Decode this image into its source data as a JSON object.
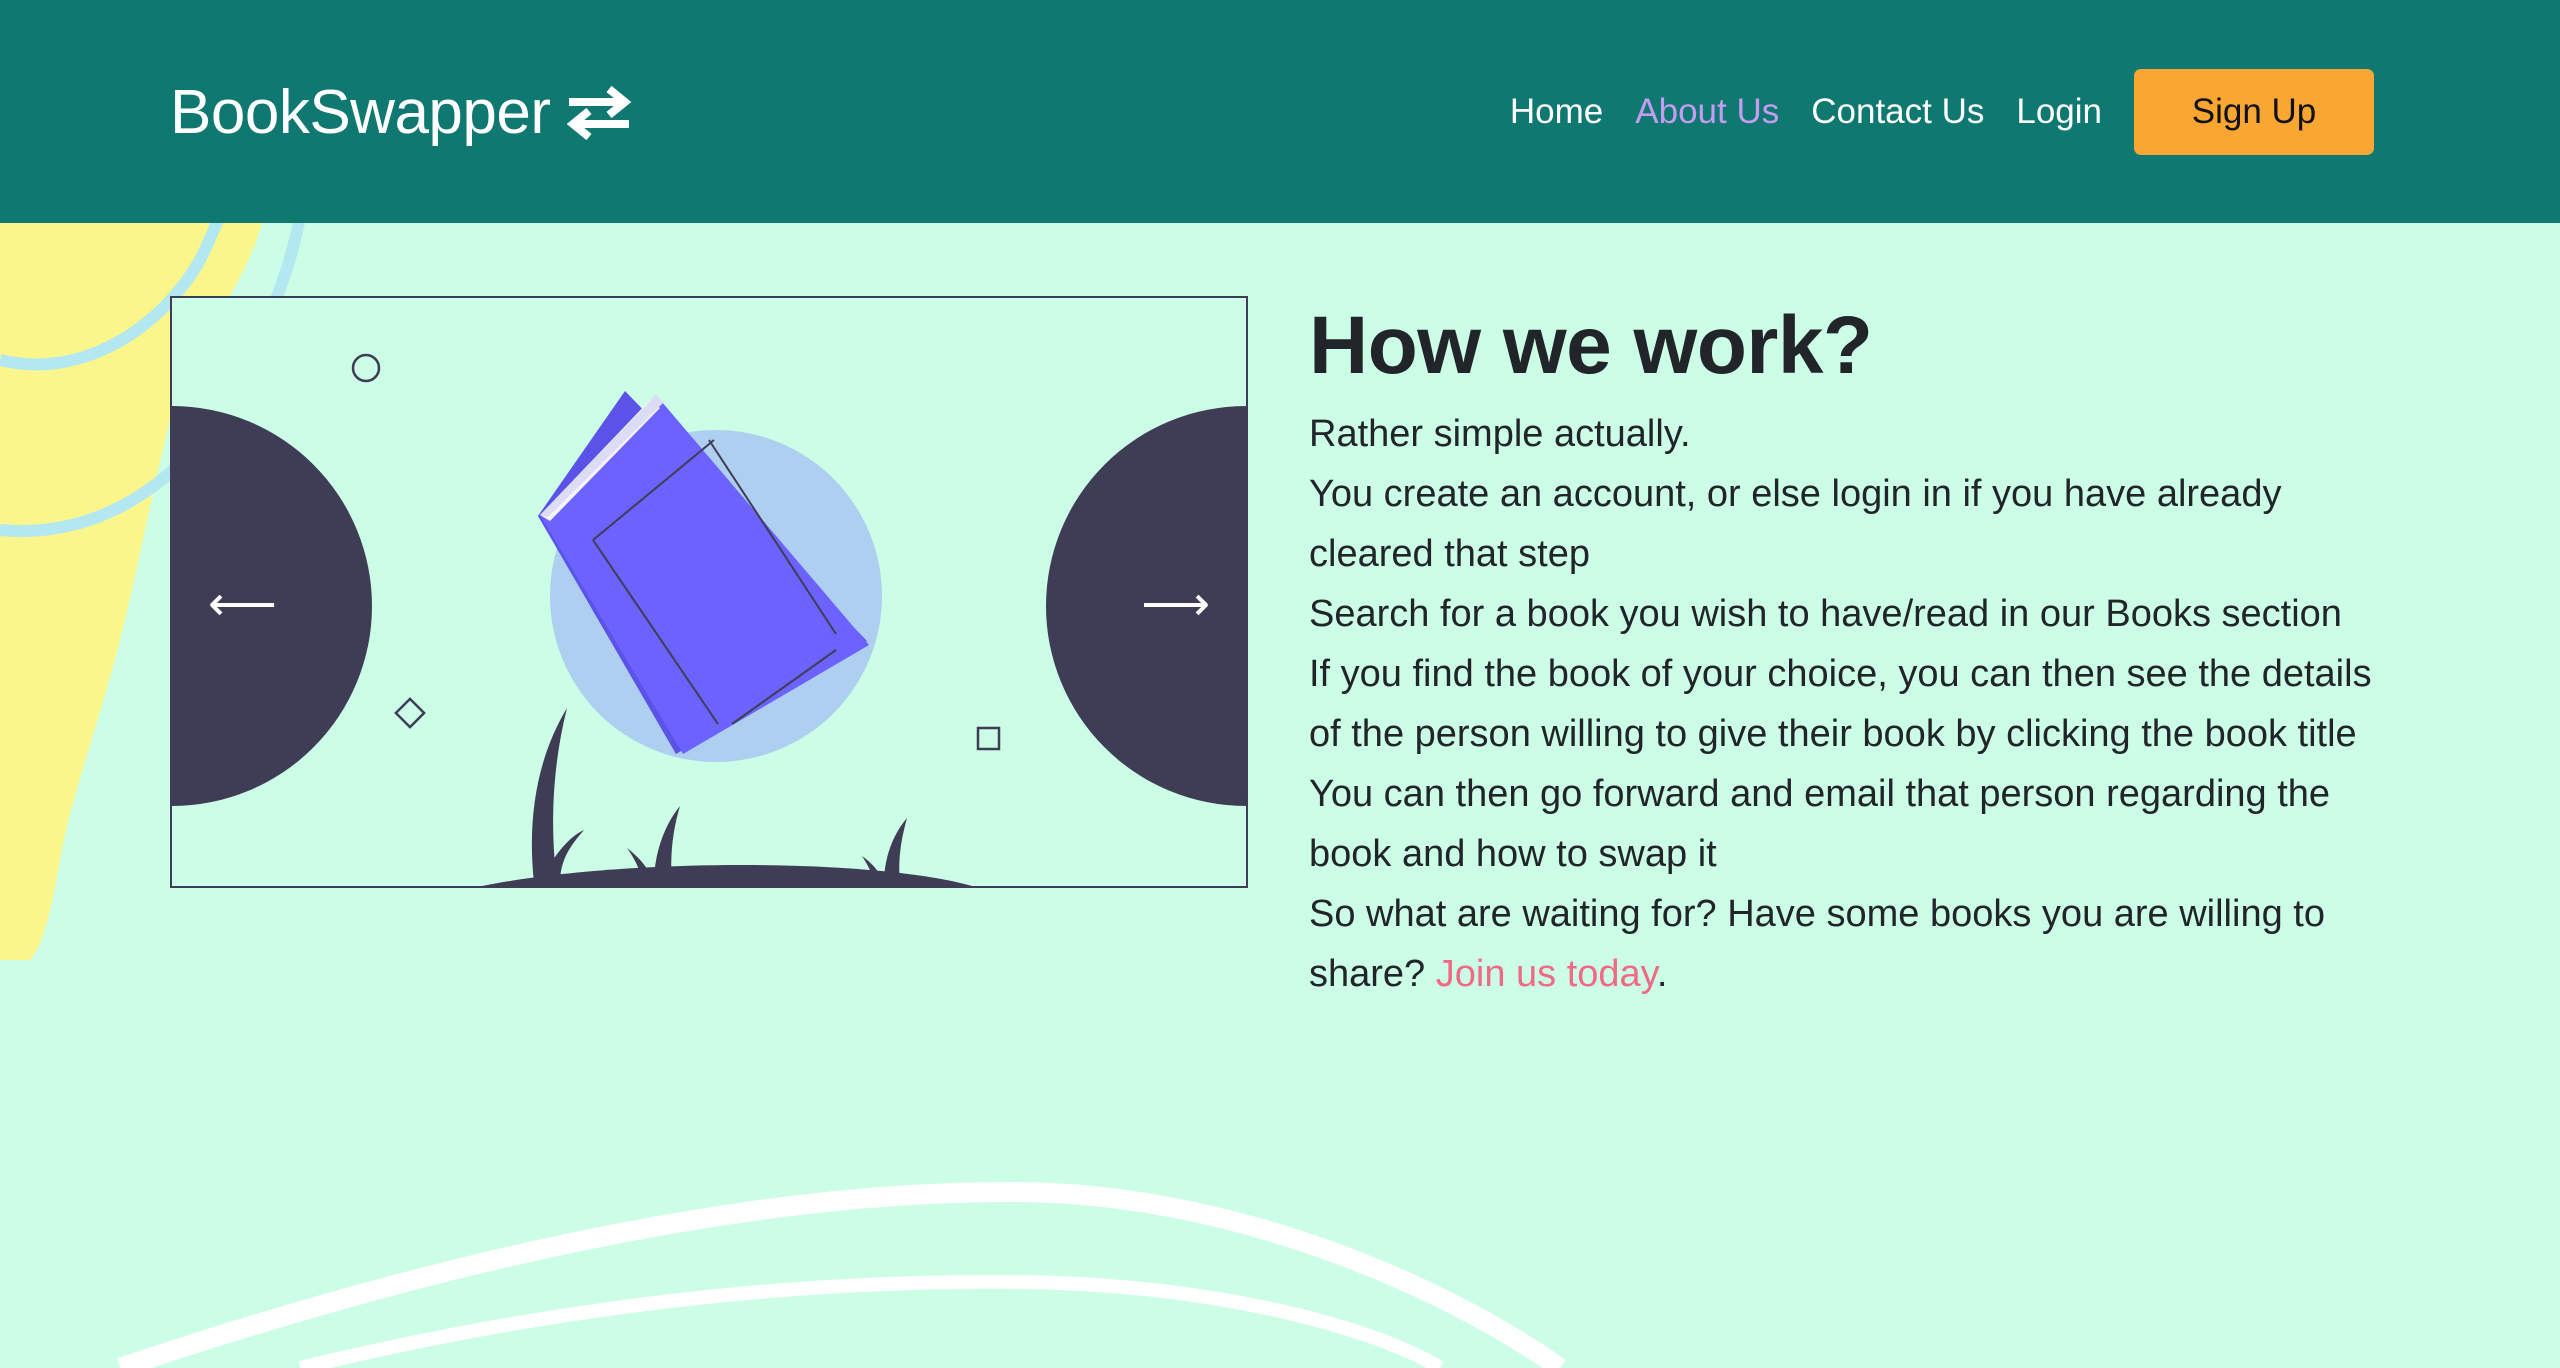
{
  "header": {
    "brand_name": "BookSwapper",
    "brand_icon": "swap-arrows-icon",
    "nav": [
      {
        "label": "Home",
        "active": false
      },
      {
        "label": "About Us",
        "active": true
      },
      {
        "label": "Contact Us",
        "active": false
      },
      {
        "label": "Login",
        "active": false
      }
    ],
    "signup_label": "Sign Up"
  },
  "carousel": {
    "illustration": "flying-book-illustration",
    "prev_icon": "arrow-left-icon",
    "next_icon": "arrow-right-icon",
    "prev_glyph": "⟵",
    "next_glyph": "⟶"
  },
  "content": {
    "heading": "How we work?",
    "lines": [
      "Rather simple actually.",
      "You create an account, or else login in if you have already cleared that step",
      "Search for a book you wish to have/read in our Books section",
      "If you find the book of your choice, you can then see the details of the person willing to give their book by clicking the book title",
      "You can then go forward and email that person regarding the book and how to swap it"
    ],
    "cta_text": "So what are waiting for? Have some books you are willing to share?",
    "cta_link": "Join us today",
    "cta_end": "."
  },
  "colors": {
    "header_bg": "#0f7870",
    "page_bg": "#ccfde6",
    "accent_orange": "#faa633",
    "active_nav": "#c39df2",
    "link_pink": "#f06a85",
    "book_purple": "#6c63ff",
    "dark": "#3f3d56"
  }
}
